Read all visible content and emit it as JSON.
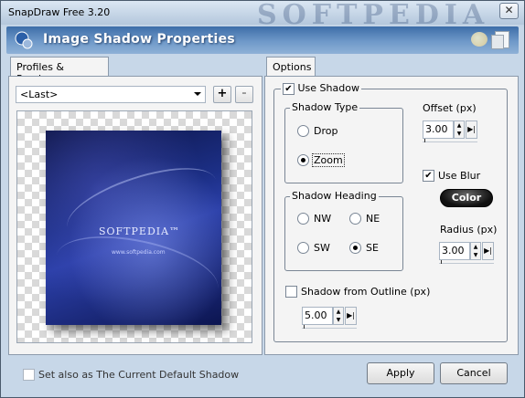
{
  "window": {
    "title": "SnapDraw Free 3.20",
    "watermark": "SOFTPEDIA"
  },
  "header": {
    "title": "Image Shadow Properties"
  },
  "left": {
    "tab_label": "Profiles & Preview",
    "profile_select": "<Last>",
    "add_label": "+",
    "remove_label": "-",
    "preview_logo": "SOFTPEDIA™",
    "preview_url": "www.softpedia.com"
  },
  "right": {
    "tab_label": "Options",
    "use_shadow": {
      "label": "Use Shadow",
      "checked": true
    },
    "shadow_type": {
      "label": "Shadow Type",
      "options": [
        {
          "label": "Drop",
          "checked": false
        },
        {
          "label": "Zoom",
          "checked": true
        }
      ]
    },
    "offset": {
      "label": "Offset (px)",
      "value": "3.00"
    },
    "use_blur": {
      "label": "Use Blur",
      "checked": true
    },
    "color_label": "Color",
    "shadow_heading": {
      "label": "Shadow Heading",
      "options": [
        {
          "label": "NW",
          "checked": false
        },
        {
          "label": "NE",
          "checked": false
        },
        {
          "label": "SW",
          "checked": false
        },
        {
          "label": "SE",
          "checked": true
        }
      ]
    },
    "radius": {
      "label": "Radius (px)",
      "value": "3.00"
    },
    "shadow_from_outline": {
      "label": "Shadow from Outline (px)",
      "checked": false,
      "value": "5.00"
    }
  },
  "footer": {
    "default_label": "Set also as The Current Default Shadow",
    "apply_label": "Apply",
    "cancel_label": "Cancel"
  }
}
